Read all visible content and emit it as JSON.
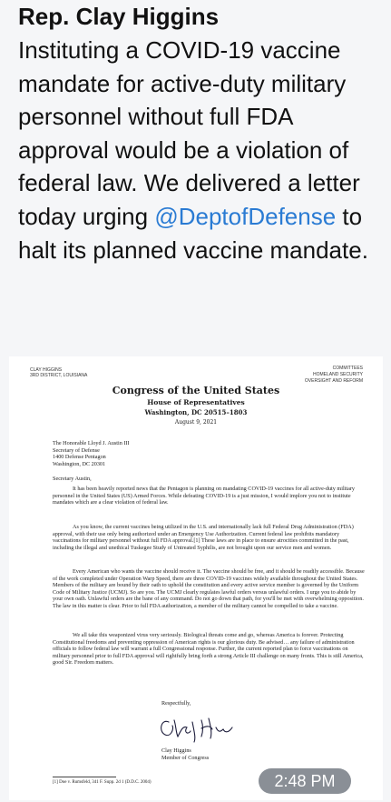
{
  "message": {
    "author": "Rep. Clay Higgins",
    "text_before": "Instituting a COVID-19 vaccine mandate for active-duty military personnel without full FDA approval would be a violation of federal law. We delivered a letter today urging",
    "mention": "@DeptofDefense",
    "text_after": " to halt its planned vaccine mandate.",
    "timestamp": "2:48 PM"
  },
  "letter": {
    "header_left": [
      "CLAY HIGGINS",
      "3RD DISTRICT, LOUISIANA"
    ],
    "header_right": [
      "COMMITTEES",
      "HOMELAND SECURITY",
      "OVERSIGHT AND REFORM"
    ],
    "congress": "Congress of the United States",
    "house": "House of Representatives",
    "city": "Washington, DC 20515–1803",
    "date": "August 9, 2021",
    "address": [
      "The Honorable Lloyd J. Austin III",
      "Secretary of Defense",
      "1400 Defense Pentagon",
      "Washington, DC 20301"
    ],
    "salutation": "Secretary Austin,",
    "para1": "It has been heavily reported news that the Pentagon is planning on mandating COVID-19 vaccines for all active-duty military personnel in the United States (US) Armed Forces. While defeating COVID-19 is a just mission, I would implore you not to institute mandates which are a clear violation of federal law.",
    "para2": "As you know, the current vaccines being utilized in the U.S. and internationally lack full Federal Drug Administration (FDA) approval, with their use only being authorized under an Emergency Use Authorization. Current federal law prohibits mandatory vaccinations for military personnel without full FDA approval.[1] These laws are in place to ensure atrocities committed in the past, including the illegal and unethical Tuskegee Study of Untreated Syphilis, are not brought upon our service men and women.",
    "para3": "Every American who wants the vaccine should receive it. The vaccine should be free, and it should be readily accessible. Because of the work completed under Operation Warp Speed, there are three COVID-19 vaccines widely available throughout the United States. Members of the military are bound by their oath to uphold the constitution and every active service member is governed by the Uniform Code of Military Justice (UCMJ). So are you. The UCMJ clearly regulates lawful orders versus unlawful orders. I urge you to abide by your own oath. Unlawful orders are the bane of any command. Do not go down that path, for you'll be met with overwhelming opposition. The law in this matter is clear. Prior to full FDA authorization, a member of the military cannot be compelled to take a vaccine.",
    "para4": "We all take this weaponized virus very seriously. Biological threats come and go, whereas America is forever. Protecting Constitutional freedoms and preventing oppression of American rights is our glorious duty. Be advised… any failure of administration officials to follow federal law will warrant a full Congressional response. Further, the current reported plan to force vaccinations on military personnel prior to full FDA approval will rightfully bring forth a strong Article III challenge on many fronts. This is still America, good Sir. Freedom matters.",
    "closing": "Respectfully,",
    "signer": "Clay Higgins",
    "signer_title": "Member of Congress",
    "footnote": "[1] Doe v. Rumsfeld, 341 F. Supp. 2d 1 (D.D.C. 2004)"
  }
}
